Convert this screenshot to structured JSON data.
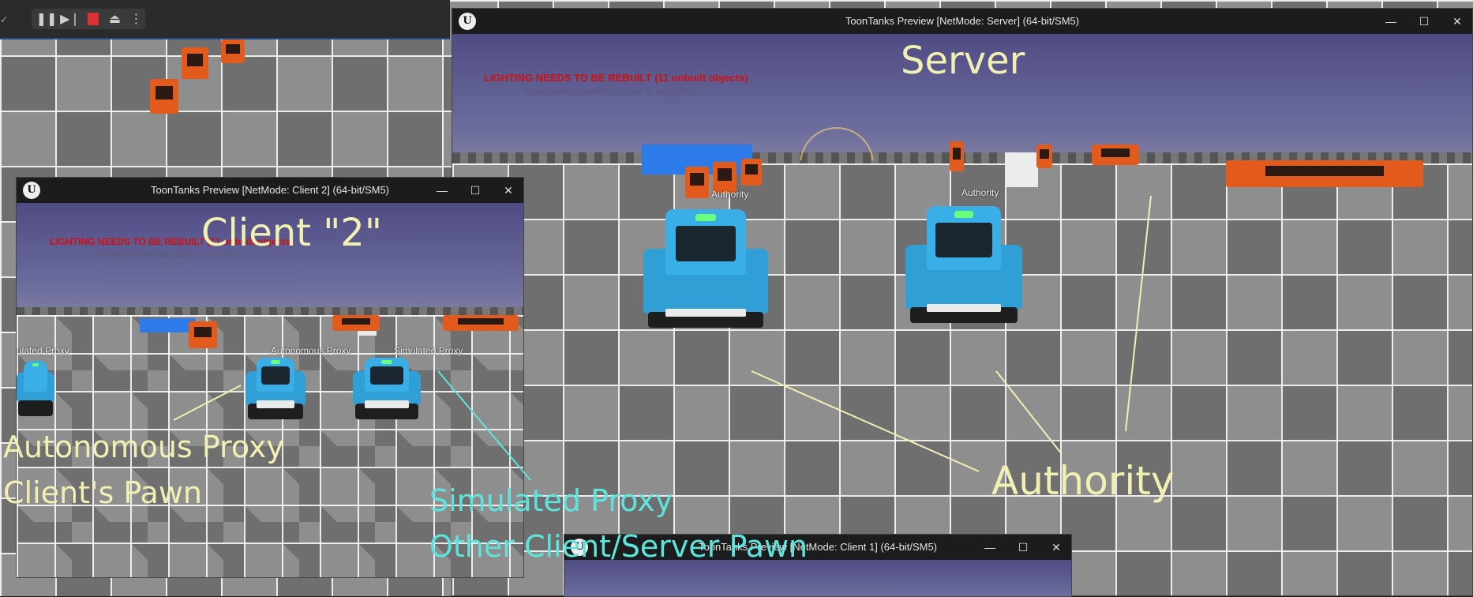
{
  "editor": {
    "toolbar_icons": [
      "pause-icon",
      "step-icon",
      "stop-icon",
      "eject-icon",
      "more-icon"
    ],
    "corner_glyph": "✓"
  },
  "server_window": {
    "title": "ToonTanks Preview [NetMode: Server]  (64-bit/SM5)",
    "warning": "LIGHTING NEEDS TO BE REBUILT (11 unbuilt objects)",
    "warning_sub": "'DisableAllScreenMessages' to suppress",
    "heading": "Server",
    "tag_left": "Authority",
    "tag_right": "Authority",
    "annotation": "Authority"
  },
  "client2_window": {
    "title": "ToonTanks Preview [NetMode: Client 2]  (64-bit/SM5)",
    "warning": "LIGHTING NEEDS TO BE REBUILT (11 unbuilt objects)",
    "warning_sub": "'DisableAllScreenMessages' to suppress",
    "heading": "Client \"2\"",
    "tag_left": "ulated Proxy",
    "tag_mid": "Autonomous Proxy",
    "tag_right": "Simulated Proxy"
  },
  "client1_window": {
    "title": "ToonTanks Preview [NetMode: Client 1]  (64-bit/SM5)"
  },
  "annotations": {
    "autonomous_line1": "Autonomous Proxy",
    "autonomous_line2": "Client's Pawn",
    "simulated_line1": "Simulated Proxy",
    "simulated_line2": "Other Client/Server Pawn"
  },
  "window_controls": {
    "minimize": "—",
    "maximize": "☐",
    "close": "✕"
  },
  "colors": {
    "annotation_yellow": "#f2efb2",
    "annotation_cyan": "#5de4dc",
    "warning_red": "#d01010",
    "tank_blue": "#2f9fd6"
  }
}
